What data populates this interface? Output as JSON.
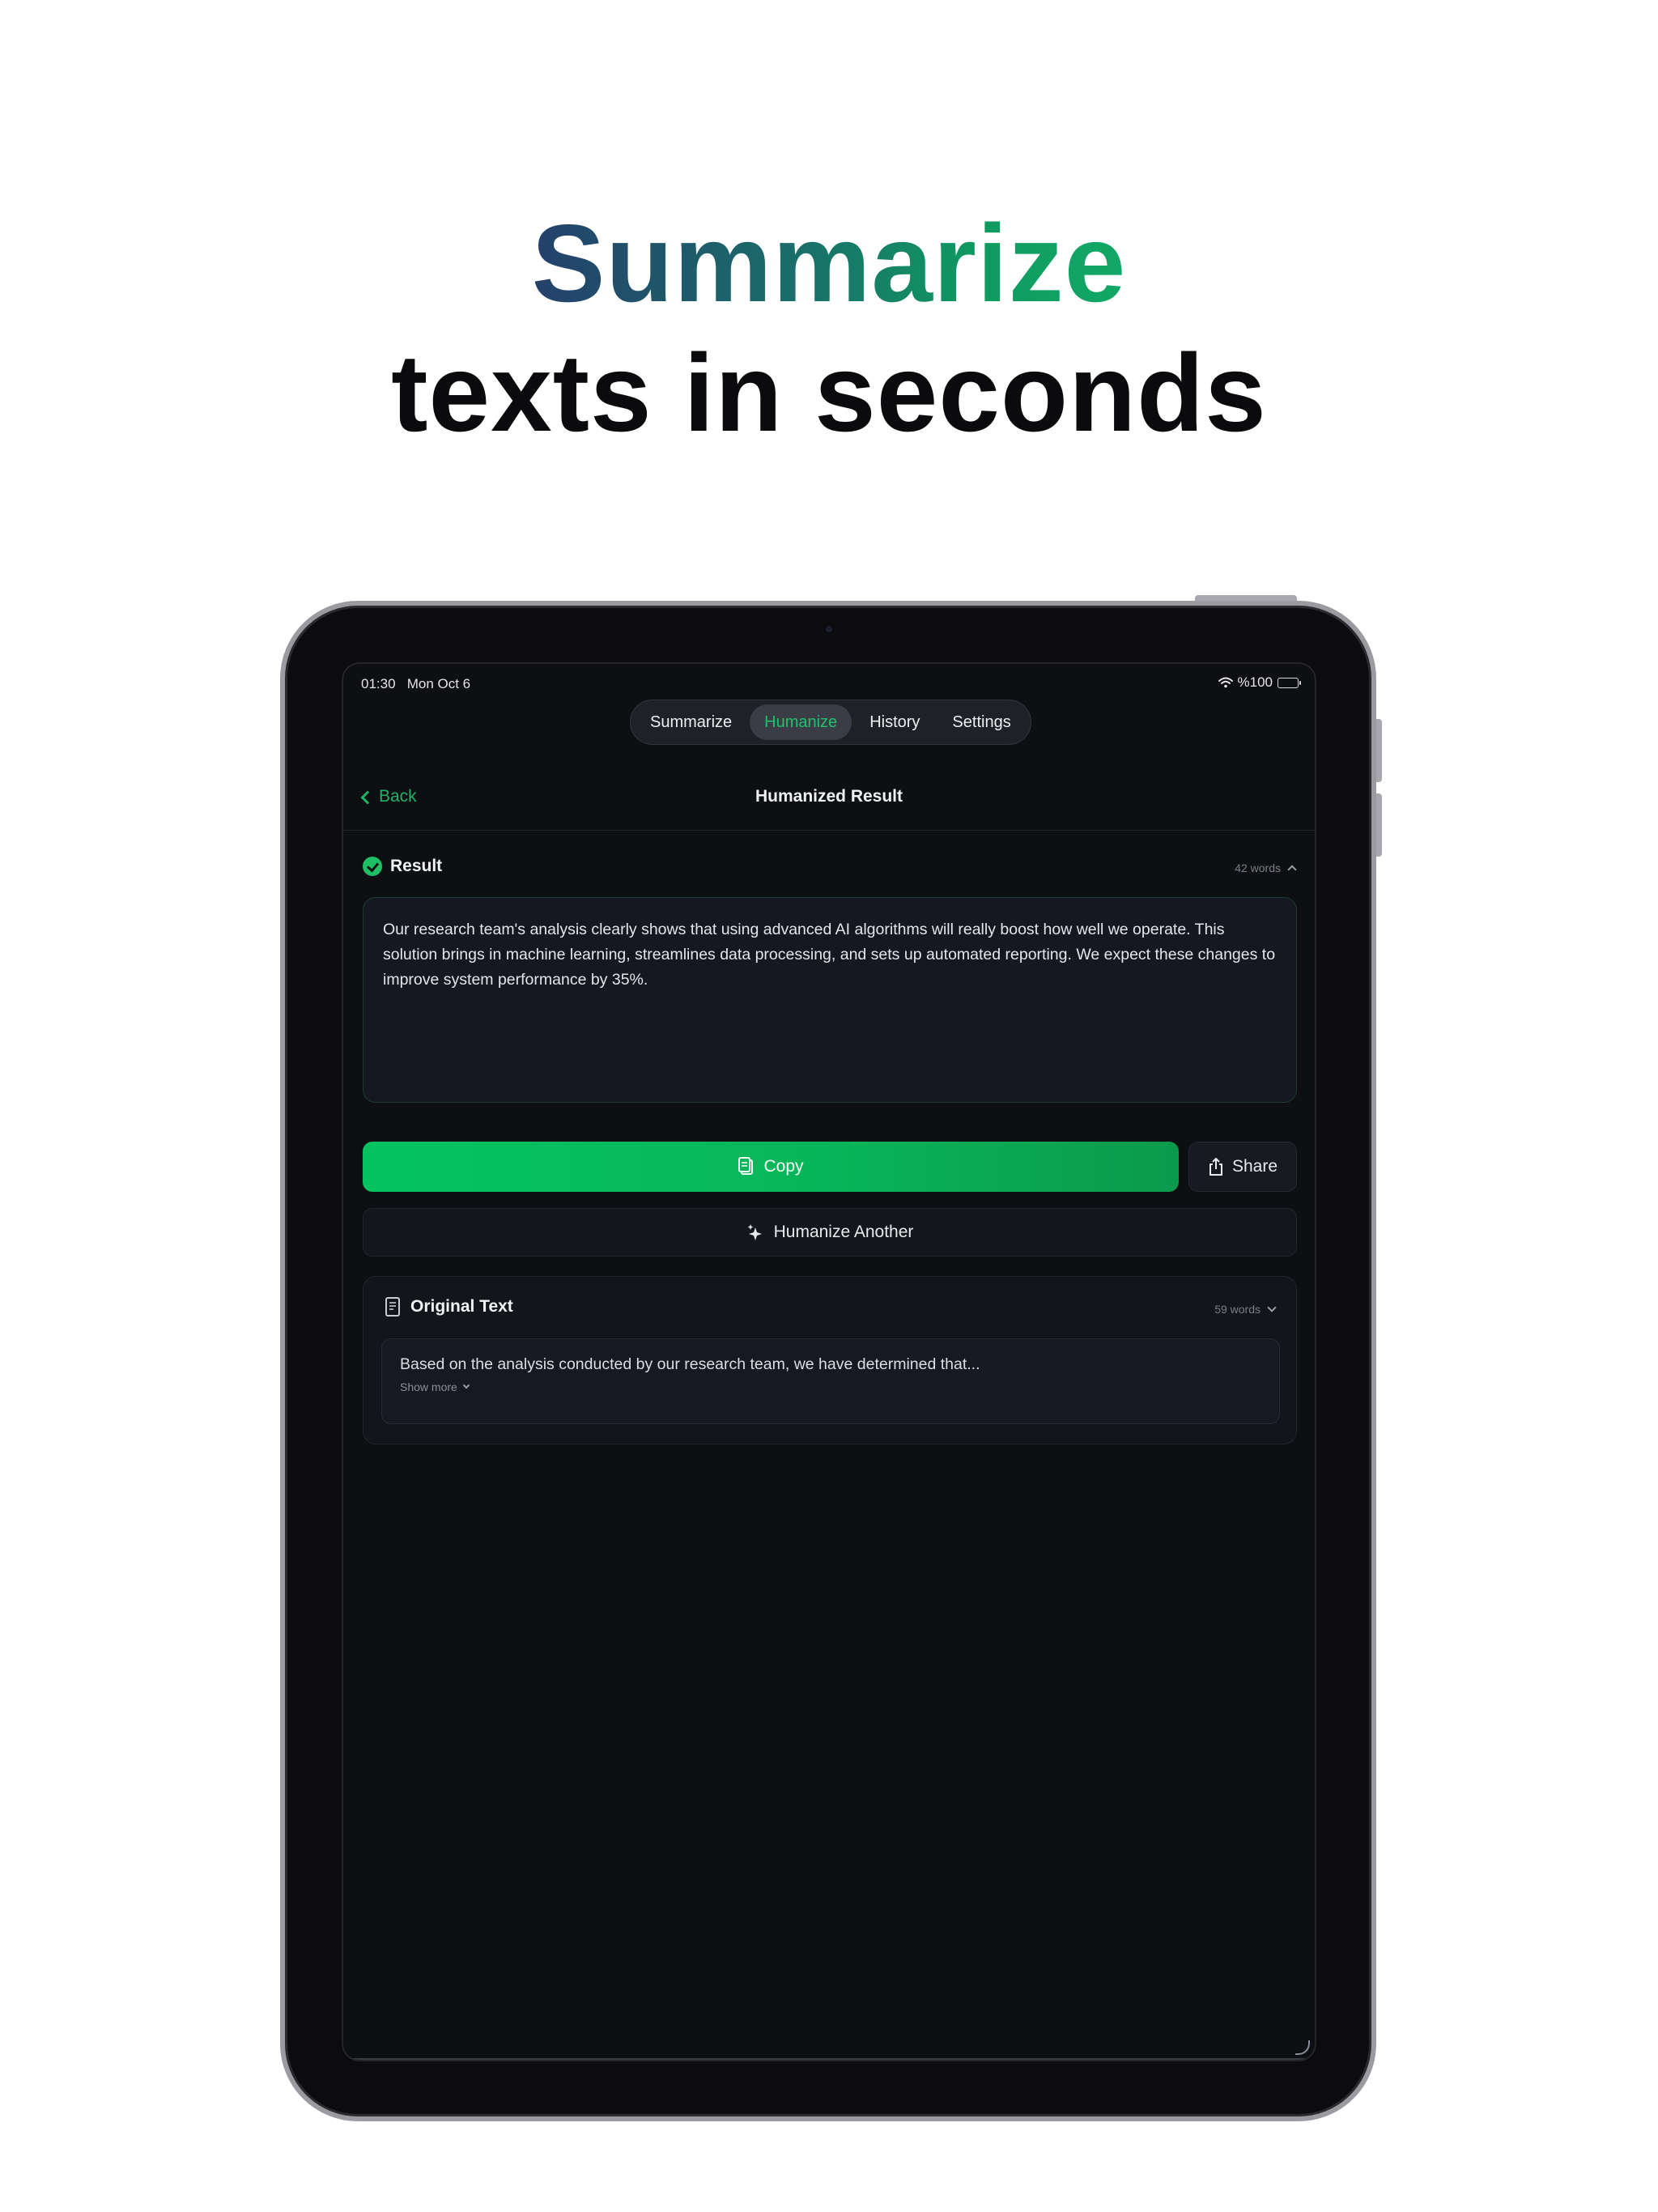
{
  "headline": {
    "line1": "Summarize",
    "line2": "texts in seconds"
  },
  "status_bar": {
    "time": "01:30",
    "date": "Mon Oct 6",
    "battery": "%100"
  },
  "tabs": [
    {
      "label": "Summarize",
      "active": false
    },
    {
      "label": "Humanize",
      "active": true
    },
    {
      "label": "History",
      "active": false
    },
    {
      "label": "Settings",
      "active": false
    }
  ],
  "navbar": {
    "back_label": "Back",
    "title": "Humanized Result"
  },
  "result": {
    "title": "Result",
    "word_count": "42 words",
    "text": "Our research team's analysis clearly shows that using advanced AI algorithms will really boost how well we operate. This solution brings in machine learning, streamlines data processing, and sets up automated reporting. We expect these changes to improve system performance by 35%."
  },
  "actions": {
    "copy_label": "Copy",
    "share_label": "Share",
    "another_label": "Humanize Another"
  },
  "original": {
    "title": "Original Text",
    "word_count": "59 words",
    "preview": "Based on the analysis conducted by our research team, we have determined that...",
    "show_more": "Show more"
  },
  "colors": {
    "accent": "#1fc26c",
    "background": "#0e0f13",
    "headline_start": "#24406b",
    "headline_end": "#12a866"
  }
}
